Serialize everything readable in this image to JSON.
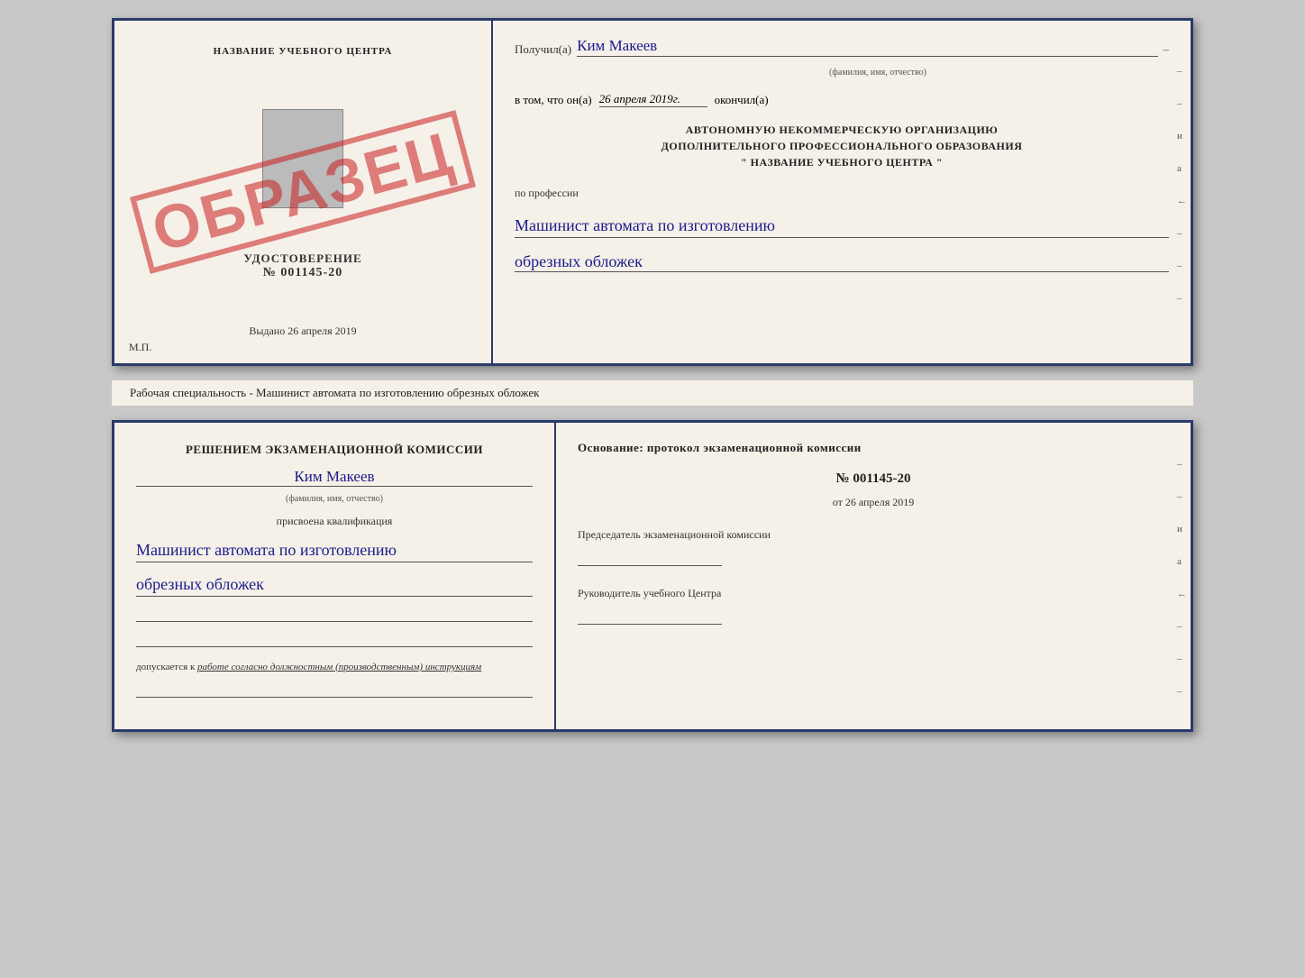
{
  "top_document": {
    "left": {
      "title": "НАЗВАНИЕ УЧЕБНОГО ЦЕНТРА",
      "stamp": "ОБРАЗЕЦ",
      "udostoverenie_label": "УДОСТОВЕРЕНИЕ",
      "number": "№ 001145-20",
      "vydano_label": "Выдано",
      "vydano_date": "26 апреля 2019",
      "mp": "М.П."
    },
    "right": {
      "poluchil_label": "Получил(а)",
      "poluchil_name": "Ким Макеев",
      "fio_subtitle": "(фамилия, имя, отчество)",
      "dash": "–",
      "vtom_label": "в том, что он(а)",
      "date_value": "26 апреля 2019г.",
      "okonchil_label": "окончил(а)",
      "org_line1": "АВТОНОМНУЮ НЕКОММЕРЧЕСКУЮ ОРГАНИЗАЦИЮ",
      "org_line2": "ДОПОЛНИТЕЛЬНОГО ПРОФЕССИОНАЛЬНОГО ОБРАЗОВАНИЯ",
      "org_name": "\" НАЗВАНИЕ УЧЕБНОГО ЦЕНТРА \"",
      "po_professii": "по профессии",
      "profession_line1": "Машинист автомата по изготовлению",
      "profession_line2": "обрезных обложек",
      "side_dashes": [
        "–",
        "–",
        "–",
        "–",
        "и",
        "а",
        "←",
        "–",
        "–",
        "–"
      ]
    }
  },
  "middle_label": "Рабочая специальность - Машинист автомата по изготовлению обрезных обложек",
  "bottom_document": {
    "left": {
      "decision_line1": "Решением экзаменационной комиссии",
      "name_cursive": "Ким Макеев",
      "fio_subtitle": "(фамилия, имя, отчество)",
      "prisvoena": "присвоена квалификация",
      "qualification_line1": "Машинист автомата по изготовлению",
      "qualification_line2": "обрезных обложек",
      "blank1": "",
      "blank2": "",
      "dopuskaetsya_prefix": "допускается к",
      "dopuskaetsya_italic": "работе согласно должностным (производственным) инструкциям"
    },
    "right": {
      "osnovanie": "Основание: протокол экзаменационной комиссии",
      "protocol_num": "№ 001145-20",
      "ot_label": "от",
      "ot_date": "26 апреля 2019",
      "predsedatel_label": "Председатель экзаменационной комиссии",
      "rukovoditel_label": "Руководитель учебного Центра",
      "side_dashes": [
        "–",
        "–",
        "–",
        "и",
        "а",
        "←",
        "–",
        "–",
        "–"
      ]
    }
  }
}
